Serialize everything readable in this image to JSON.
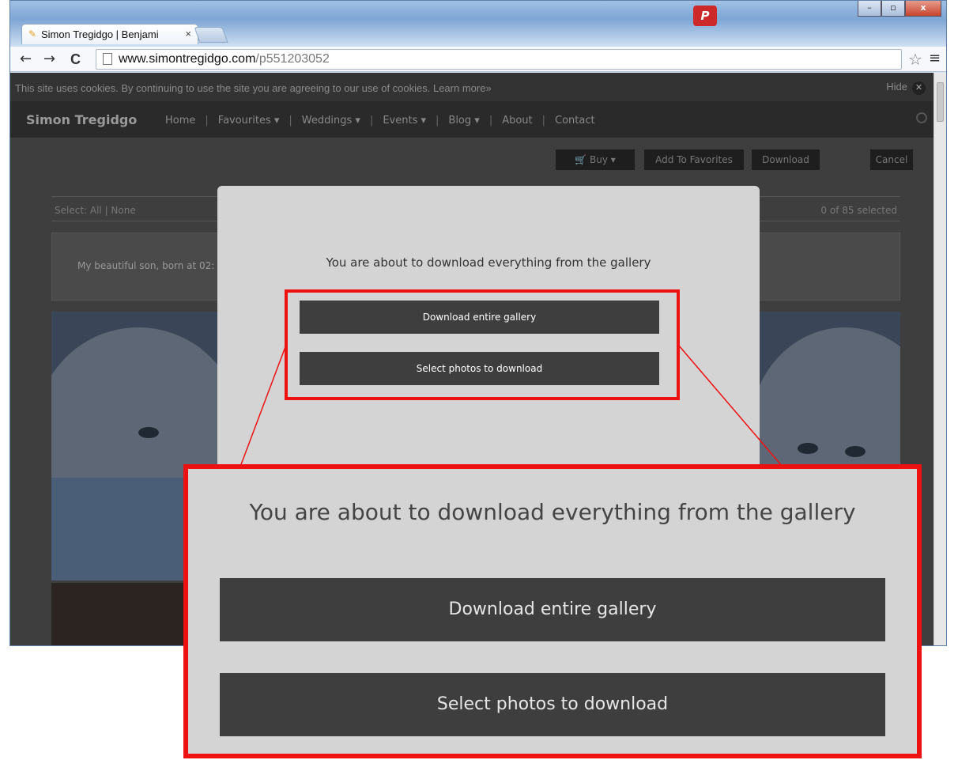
{
  "browser": {
    "tab_title": "Simon Tregidgo | Benjami",
    "tab_close": "×",
    "url_domain": "www.simontregidgo.com",
    "url_path": "/p551203052",
    "back": "←",
    "forward": "→",
    "reload": "C",
    "star": "☆",
    "menu": "≡",
    "extension_letter": "P",
    "win_min": "–",
    "win_max": "▫",
    "win_close": "x"
  },
  "cookie_bar": {
    "text": "This site uses cookies. By continuing to use the site you are agreeing to our use of cookies. Learn more»",
    "hide_label": "Hide",
    "hide_icon": "✕"
  },
  "site_nav": {
    "brand": "Simon Tregidgo",
    "items": [
      "Home",
      "Favourites ▾",
      "Weddings ▾",
      "Events ▾",
      "Blog ▾",
      "About",
      "Contact"
    ],
    "separator": "|"
  },
  "actions": {
    "buy": "🛒 Buy ▾",
    "add_favorites": "Add To Favorites",
    "download": "Download",
    "cancel": "Cancel"
  },
  "gallery": {
    "select_label": "Select: All | None",
    "selected_count": "0 of 85 selected",
    "caption": "My beautiful son, born at 02:"
  },
  "modal": {
    "message": "You are about to download everything from the gallery",
    "download_all": "Download entire gallery",
    "select_photos": "Select photos to download"
  },
  "colors": {
    "highlight": "#ee1111",
    "modal_bg": "#d4d4d4",
    "button_bg": "#3e3e3e"
  }
}
